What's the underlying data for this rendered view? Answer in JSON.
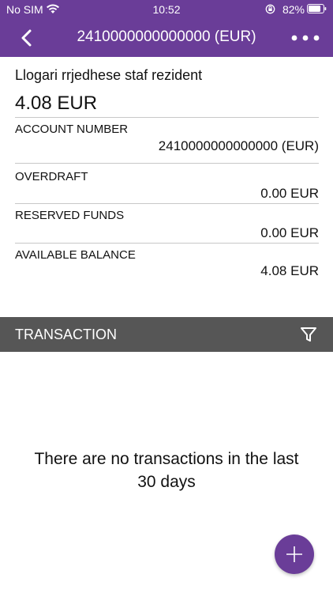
{
  "status_bar": {
    "carrier": "No SIM",
    "time": "10:52",
    "battery": "82%"
  },
  "nav": {
    "title": "2410000000000000 (EUR)"
  },
  "account": {
    "name": "Llogari rrjedhese staf rezident",
    "balance": "4.08 EUR",
    "account_number_label": "ACCOUNT NUMBER",
    "account_number_value": "2410000000000000 (EUR)",
    "overdraft_label": "OVERDRAFT",
    "overdraft_value": "0.00 EUR",
    "reserved_label": "RESERVED FUNDS",
    "reserved_value": "0.00 EUR",
    "available_label": "AVAILABLE BALANCE",
    "available_value": "4.08 EUR"
  },
  "transactions": {
    "section_title": "TRANSACTION",
    "empty_message_line1": "There are no transactions in the last",
    "empty_message_line2": "30 days"
  },
  "colors": {
    "brand": "#6a3d98",
    "section_bar": "#565656"
  },
  "icons": [
    "wifi-icon",
    "rotation-lock-icon",
    "battery-icon",
    "back-chevron-icon",
    "more-dots-icon",
    "filter-icon",
    "plus-icon"
  ]
}
